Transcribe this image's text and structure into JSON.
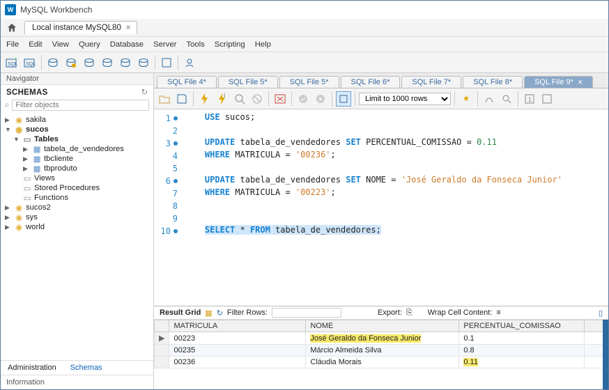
{
  "window": {
    "title": "MySQL Workbench"
  },
  "connection_tab": {
    "label": "Local instance MySQL80"
  },
  "menu": [
    "File",
    "Edit",
    "View",
    "Query",
    "Database",
    "Server",
    "Tools",
    "Scripting",
    "Help"
  ],
  "navigator": {
    "title": "Navigator",
    "schemas_label": "SCHEMAS",
    "filter_placeholder": "Filter objects",
    "tabs": {
      "admin": "Administration",
      "schemas": "Schemas"
    },
    "info": "Information",
    "tree": {
      "sakila": "sakila",
      "sucos": "sucos",
      "tables": "Tables",
      "t1": "tabela_de_vendedores",
      "t2": "tbcliente",
      "t3": "tbproduto",
      "views": "Views",
      "sp": "Stored Procedures",
      "fn": "Functions",
      "sucos2": "sucos2",
      "sys": "sys",
      "world": "world"
    }
  },
  "tabs": [
    "SQL File 4*",
    "SQL File 5*",
    "SQL File 5*",
    "SQL File 6*",
    "SQL File 7*",
    "SQL File 8*",
    "SQL File 9*"
  ],
  "editor_toolbar": {
    "limit": "Limit to 1000 rows"
  },
  "code": {
    "l1a": "USE",
    "l1b": " sucos;",
    "l3a": "UPDATE",
    "l3b": " tabela_de_vendedores ",
    "l3c": "SET",
    "l3d": " PERCENTUAL_COMISSAO = ",
    "l3e": "0.11",
    "l4a": "WHERE",
    "l4b": " MATRICULA = ",
    "l4c": "'00236'",
    "l4d": ";",
    "l6a": "UPDATE",
    "l6b": " tabela_de_vendedores ",
    "l6c": "SET",
    "l6d": " NOME = ",
    "l6e": "'José Geraldo da Fonseca Junior'",
    "l7a": "WHERE",
    "l7b": " MATRICULA = ",
    "l7c": "'00223'",
    "l7d": ";",
    "l10a": "SELECT",
    "l10b": " * ",
    "l10c": "FROM",
    "l10d": " tabela_de_vendedores;"
  },
  "result_toolbar": {
    "result_grid": "Result Grid",
    "filter_rows": "Filter Rows:",
    "export": "Export:",
    "wrap": "Wrap Cell Content:"
  },
  "grid": {
    "headers": {
      "c1": "MATRICULA",
      "c2": "NOME",
      "c3": "PERCENTUAL_COMISSAO"
    },
    "rows": [
      {
        "c1": "00223",
        "c2": "José Geraldo da Fonseca Junior",
        "c3": "0.1",
        "hl": [
          "c2"
        ]
      },
      {
        "c1": "00235",
        "c2": "Márcio Almeida Silva",
        "c3": "0.8",
        "hl": []
      },
      {
        "c1": "00236",
        "c2": "Cláudia Morais",
        "c3": "0.11",
        "hl": [
          "c3"
        ]
      }
    ]
  }
}
